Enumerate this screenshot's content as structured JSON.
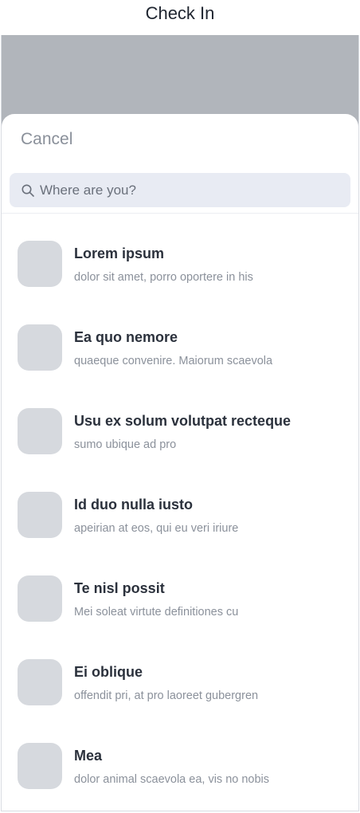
{
  "header": {
    "title": "Check In"
  },
  "sheet": {
    "cancel_label": "Cancel"
  },
  "search": {
    "placeholder": "Where are you?",
    "icon": "search-icon"
  },
  "places": [
    {
      "title": "Lorem ipsum",
      "subtitle": "dolor sit amet, porro oportere in his"
    },
    {
      "title": "Ea quo nemore",
      "subtitle": "quaeque convenire. Maiorum scaevola"
    },
    {
      "title": "Usu ex solum volutpat recteque",
      "subtitle": "sumo ubique ad pro"
    },
    {
      "title": "Id duo nulla iusto",
      "subtitle": "apeirian at eos, qui eu veri iriure"
    },
    {
      "title": "Te nisl possit",
      "subtitle": "Mei soleat virtute definitiones cu"
    },
    {
      "title": "Ei oblique",
      "subtitle": "offendit pri, at pro laoreet gubergren"
    },
    {
      "title": "Mea",
      "subtitle": "dolor animal scaevola ea, vis no nobis"
    }
  ]
}
